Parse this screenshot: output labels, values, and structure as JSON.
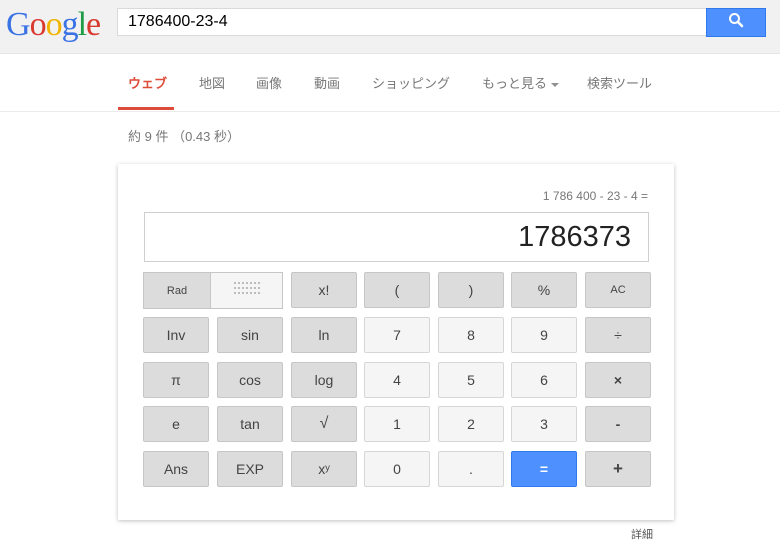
{
  "header": {
    "logo_letters": [
      {
        "ch": "G",
        "color": "#3b73e4"
      },
      {
        "ch": "o",
        "color": "#d93a2f"
      },
      {
        "ch": "o",
        "color": "#f0b400"
      },
      {
        "ch": "g",
        "color": "#3b73e4"
      },
      {
        "ch": "l",
        "color": "#1e9b45"
      },
      {
        "ch": "e",
        "color": "#d93a2f"
      }
    ],
    "search_value": "1786400-23-4",
    "search_button_icon": "search-icon"
  },
  "tabs": [
    {
      "label": "ウェブ",
      "active": true
    },
    {
      "label": "地図"
    },
    {
      "label": "画像"
    },
    {
      "label": "動画"
    },
    {
      "label": "ショッピング"
    },
    {
      "label": "もっと見る"
    },
    {
      "label": "検索ツール"
    }
  ],
  "stats": "約 9 件 （0.43 秒）",
  "calculator": {
    "expression": "1 786 400 - 23 - 4 =",
    "result": "1786373",
    "mode_rad": "Rad",
    "mode_deg_icon": "dotted-grid-icon",
    "keys": [
      [
        "x!",
        "(",
        ")",
        "%",
        "AC"
      ],
      [
        "Inv",
        "sin",
        "ln",
        "7",
        "8",
        "9",
        "÷"
      ],
      [
        "π",
        "cos",
        "log",
        "4",
        "5",
        "6",
        "×"
      ],
      [
        "e",
        "tan",
        "√",
        "1",
        "2",
        "3",
        "-"
      ],
      [
        "Ans",
        "EXP",
        "xʸ",
        "0",
        ".",
        "=",
        "+"
      ]
    ]
  },
  "footer": {
    "detail_link": "詳細"
  },
  "colors": {
    "accent_red": "#dd4b39",
    "blue_button": "#4d90fe"
  }
}
